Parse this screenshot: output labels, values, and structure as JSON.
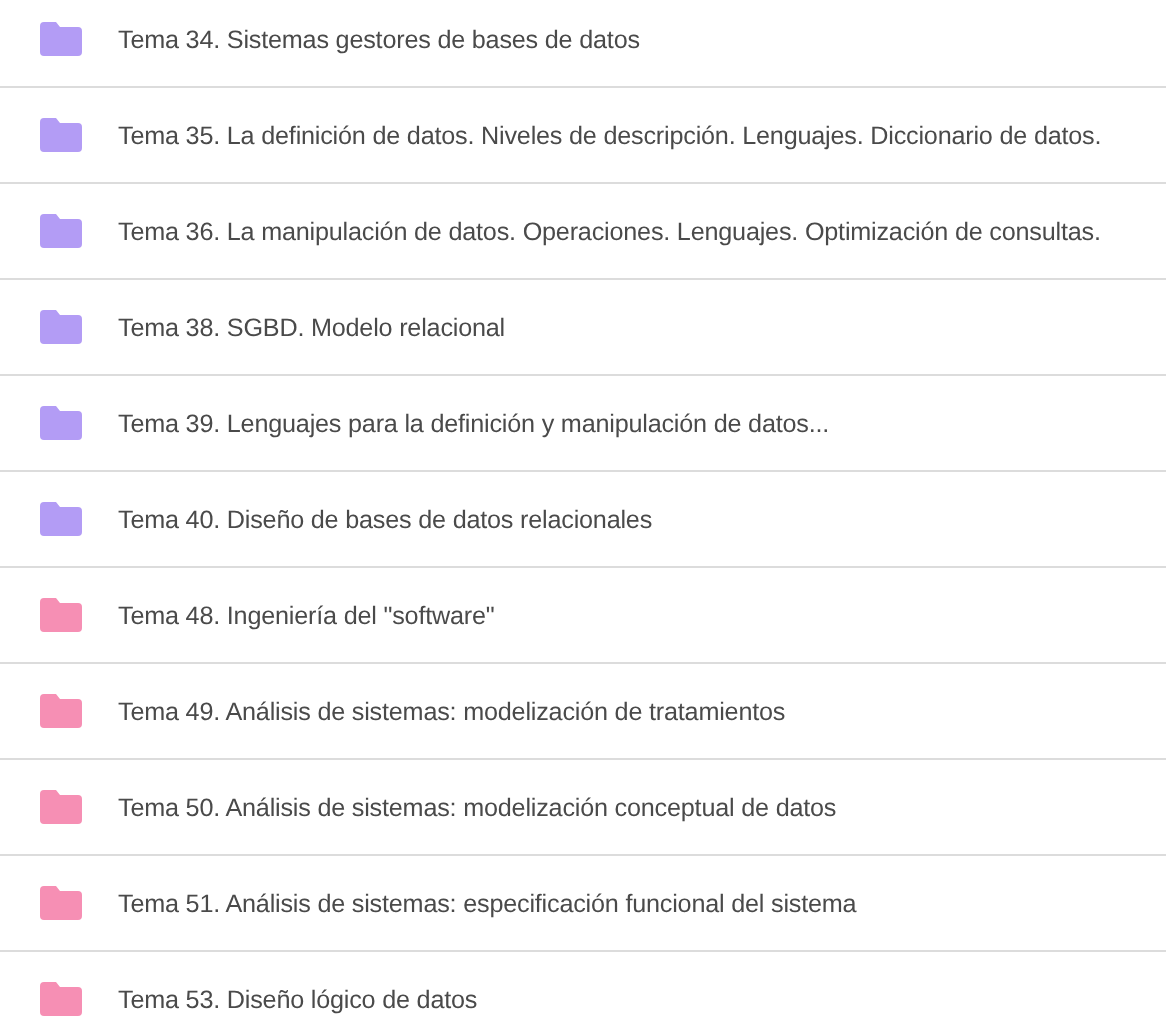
{
  "folders": [
    {
      "name": "Tema 34. Sistemas gestores de bases de datos",
      "color": "#b39cf5"
    },
    {
      "name": "Tema 35. La definición de datos. Niveles de descripción. Lenguajes. Diccionario de datos.",
      "color": "#b39cf5"
    },
    {
      "name": "Tema 36. La manipulación de datos. Operaciones. Lenguajes. Optimización de consultas.",
      "color": "#b39cf5"
    },
    {
      "name": "Tema 38. SGBD. Modelo relacional",
      "color": "#b39cf5"
    },
    {
      "name": "Tema 39. Lenguajes para la definición y manipulación de datos...",
      "color": "#b39cf5"
    },
    {
      "name": "Tema 40. Diseño de bases de datos relacionales",
      "color": "#b39cf5"
    },
    {
      "name": "Tema 48. Ingeniería del \"software\"",
      "color": "#f68fb4"
    },
    {
      "name": "Tema 49. Análisis de sistemas: modelización de tratamientos",
      "color": "#f68fb4"
    },
    {
      "name": "Tema 50. Análisis de sistemas: modelización conceptual de datos",
      "color": "#f68fb4"
    },
    {
      "name": "Tema 51. Análisis de sistemas: especificación funcional del sistema",
      "color": "#f68fb4"
    },
    {
      "name": "Tema 53. Diseño lógico de datos",
      "color": "#f68fb4"
    }
  ]
}
